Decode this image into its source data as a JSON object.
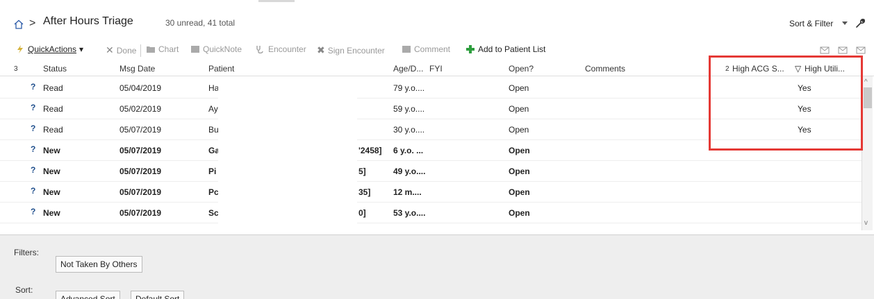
{
  "header": {
    "separator": ">",
    "title": "After Hours Triage",
    "subtitle": "30 unread, 41 total",
    "sort_filter_label": "Sort & Filter"
  },
  "toolbar": {
    "quick_actions": "QuickActions",
    "done": "Done",
    "chart": "Chart",
    "quick_note": "QuickNote",
    "encounter": "Encounter",
    "sign_encounter": "Sign Encounter",
    "comment": "Comment",
    "add_to_patient_list": "Add to Patient List"
  },
  "columns": {
    "sort_index_1": "3",
    "status": "Status",
    "msg_date": "Msg Date",
    "patient": "Patient",
    "age": "Age/D...",
    "fyi": "FYI",
    "open": "Open?",
    "comments": "Comments",
    "sort_index_2": "2",
    "high_acg": "High ACG S...",
    "high_util": "High Utili..."
  },
  "rows": [
    {
      "status": "Read",
      "date": "05/04/2019",
      "patient": "Ha",
      "mrn": "",
      "age": "79 y.o....",
      "open": "Open",
      "high_util": "Yes",
      "bold": false
    },
    {
      "status": "Read",
      "date": "05/02/2019",
      "patient": "Ay",
      "mrn": "",
      "age": "59 y.o....",
      "open": "Open",
      "high_util": "Yes",
      "bold": false
    },
    {
      "status": "Read",
      "date": "05/07/2019",
      "patient": "Bu",
      "mrn": "",
      "age": "30 y.o....",
      "open": "Open",
      "high_util": "Yes",
      "bold": false
    },
    {
      "status": "New",
      "date": "05/07/2019",
      "patient": "Ga",
      "mrn": "'2458]",
      "age": "6 y.o. ...",
      "open": "Open",
      "high_util": "",
      "bold": true
    },
    {
      "status": "New",
      "date": "05/07/2019",
      "patient": "Pi",
      "mrn": "5]",
      "age": "49 y.o....",
      "open": "Open",
      "high_util": "",
      "bold": true
    },
    {
      "status": "New",
      "date": "05/07/2019",
      "patient": "Pc",
      "mrn": "35]",
      "age": "12 m....",
      "open": "Open",
      "high_util": "",
      "bold": true
    },
    {
      "status": "New",
      "date": "05/07/2019",
      "patient": "Sc",
      "mrn": "0]",
      "age": "53 y.o....",
      "open": "Open",
      "high_util": "",
      "bold": true
    }
  ],
  "filters": {
    "filters_label": "Filters:",
    "not_taken_by_others": "Not Taken By Others",
    "sort_label": "Sort:",
    "advanced_sort": "Advanced Sort",
    "default_sort": "Default Sort"
  },
  "colors": {
    "highlight": "#e53935",
    "add_icon": "#2e9e3e",
    "status_icon": "#1f4e8c"
  }
}
